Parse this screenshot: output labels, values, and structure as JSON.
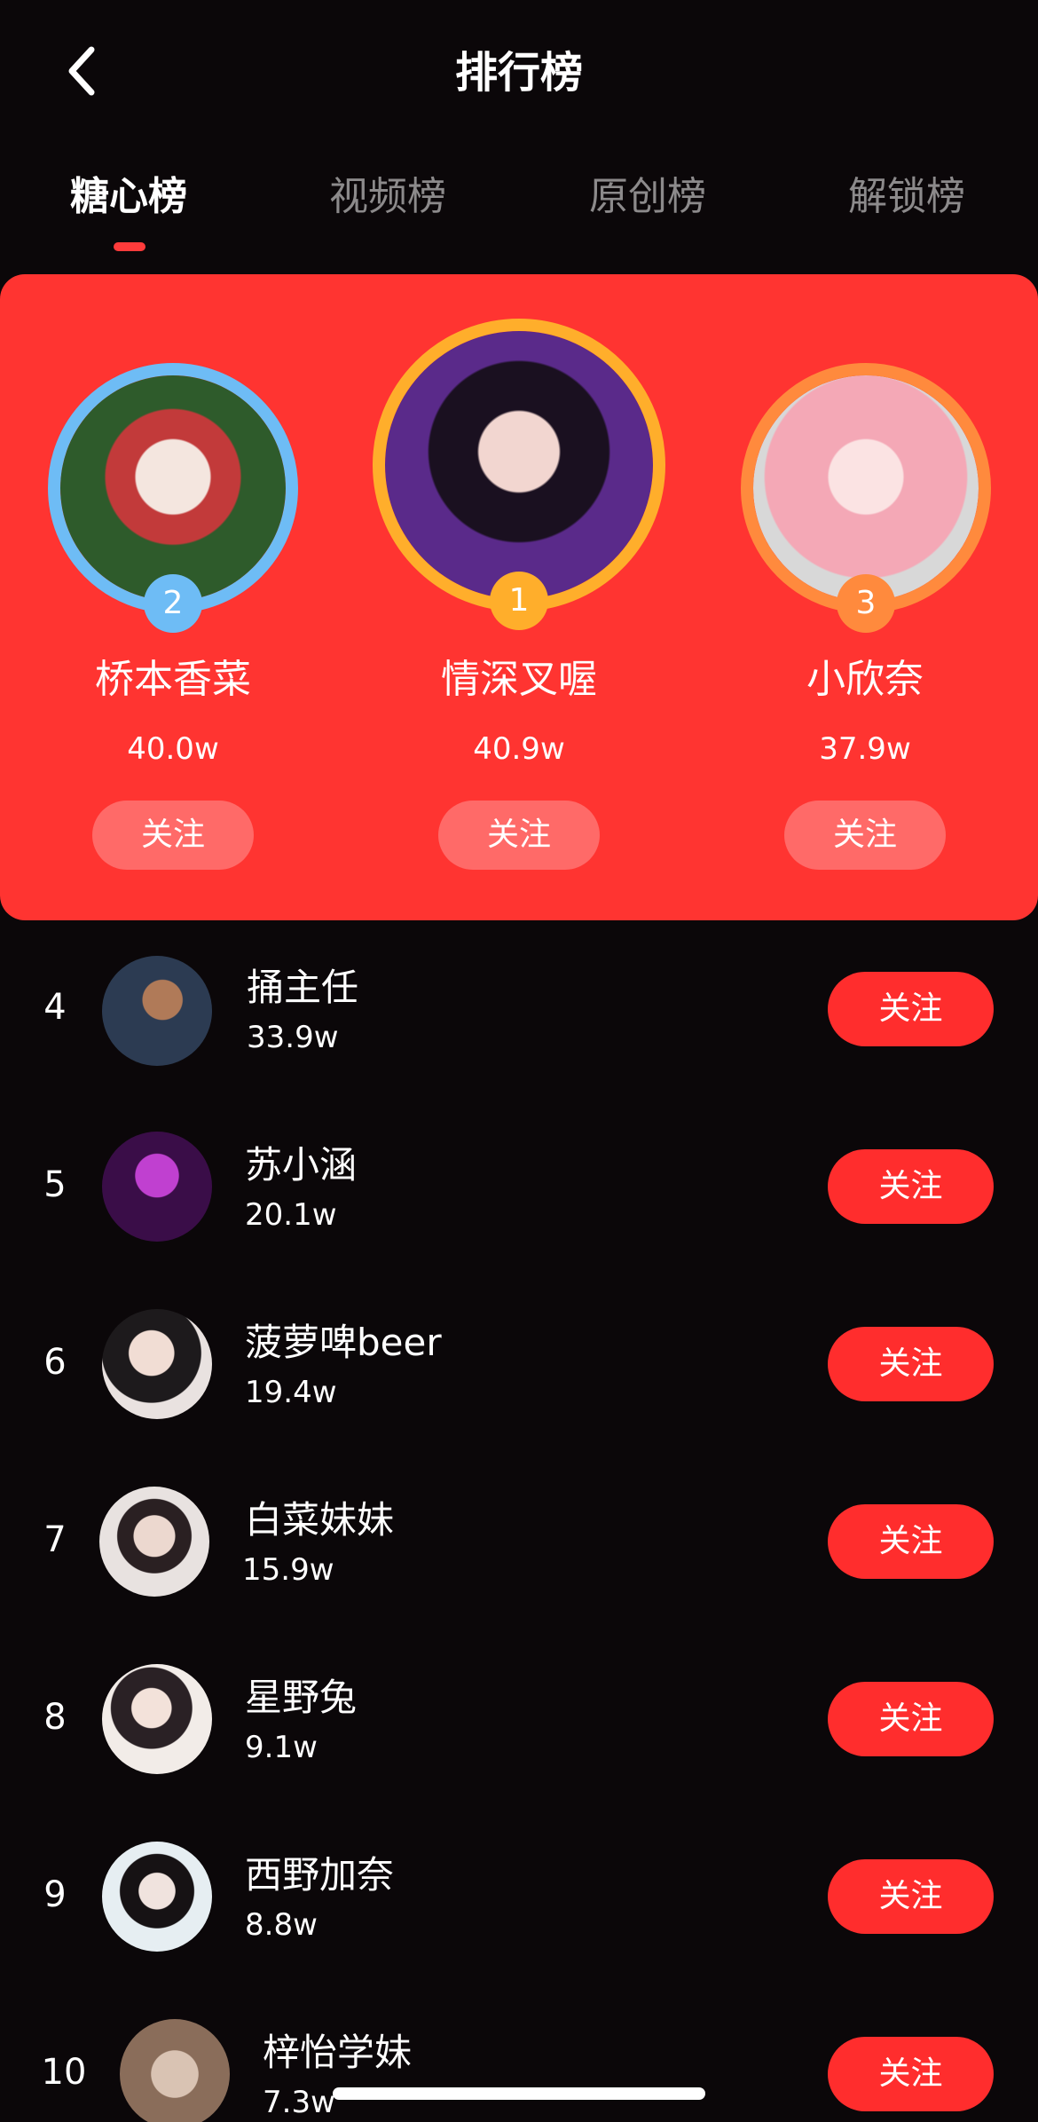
{
  "header": {
    "title": "排行榜",
    "back_icon": "chevron-left-icon"
  },
  "tabs": [
    {
      "label": "糖心榜",
      "active": true
    },
    {
      "label": "视频榜",
      "active": false
    },
    {
      "label": "原创榜",
      "active": false
    },
    {
      "label": "解锁榜",
      "active": false
    }
  ],
  "podium": {
    "first": {
      "rank": "1",
      "name": "情深叉喔",
      "score": "40.9w",
      "follow_label": "关注",
      "ring_color": "#ffae2b"
    },
    "second": {
      "rank": "2",
      "name": "桥本香菜",
      "score": "40.0w",
      "follow_label": "关注",
      "ring_color": "#6ebcf5"
    },
    "third": {
      "rank": "3",
      "name": "小欣奈",
      "score": "37.9w",
      "follow_label": "关注",
      "ring_color": "#ff8a3d"
    }
  },
  "list": [
    {
      "rank": "4",
      "name": "捅主任",
      "score": "33.9w",
      "follow_label": "关注"
    },
    {
      "rank": "5",
      "name": "苏小涵",
      "score": "20.1w",
      "follow_label": "关注"
    },
    {
      "rank": "6",
      "name": "菠萝啤beer",
      "score": "19.4w",
      "follow_label": "关注"
    },
    {
      "rank": "7",
      "name": "白菜妹妹",
      "score": "15.9w",
      "follow_label": "关注"
    },
    {
      "rank": "8",
      "name": "星野兔",
      "score": "9.1w",
      "follow_label": "关注"
    },
    {
      "rank": "9",
      "name": "西野加奈",
      "score": "8.8w",
      "follow_label": "关注"
    },
    {
      "rank": "10",
      "name": "梓怡学妹",
      "score": "7.3w",
      "follow_label": "关注"
    }
  ],
  "colors": {
    "background": "#0b0709",
    "accent": "#ff3431",
    "follow_button": "#ff2d2d",
    "podium_follow_button": "#ff6a68",
    "inactive_tab": "#8c8a8b"
  }
}
